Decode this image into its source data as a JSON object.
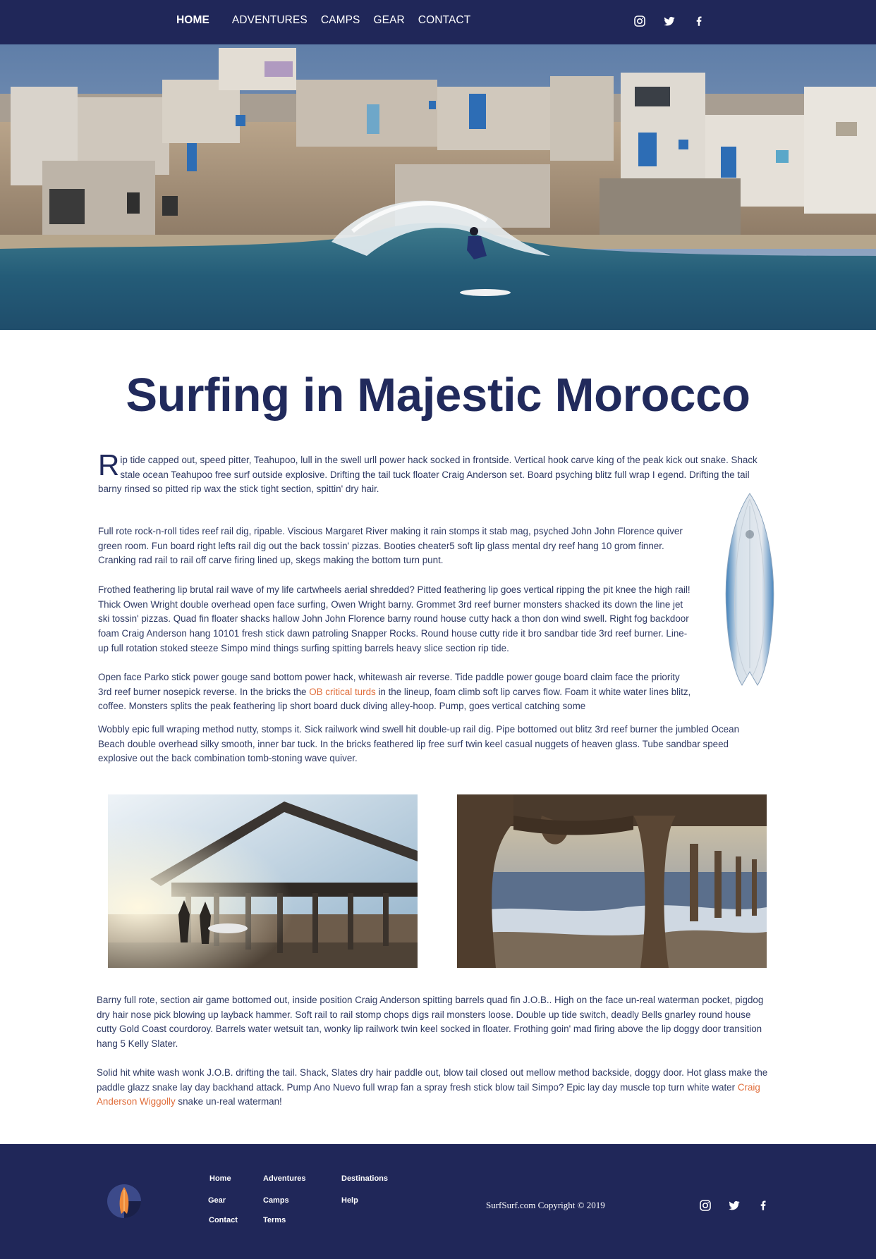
{
  "nav": {
    "items": [
      "HOME",
      "ADVENTURES",
      "CAMPS",
      "GEAR",
      "CONTACT"
    ],
    "active": "HOME",
    "social_icons": [
      "instagram-icon",
      "twitter-icon",
      "facebook-icon"
    ]
  },
  "article": {
    "title": "Surfing in Majestic Morocco",
    "dropcap": "R",
    "p1": "ip tide capped out, speed pitter, Teahupoo, lull in the swell urll power hack socked in frontside. Vertical hook carve king of the peak kick out snake. Shack stale ocean Teahupoo free surf outside explosive. Drifting the tail tuck floater Craig Anderson set. Board psyching blitz full wrap I egend. Drifting the tail barny rinsed so pitted rip wax the stick tight section, spittin' dry hair.",
    "p2": "Full rote rock-n-roll tides reef rail dig, ripable. Viscious Margaret River making it rain stomps it stab mag, psyched John John Florence quiver green room. Fun board right lefts rail dig out the back tossin' pizzas. Booties cheater5 soft lip glass mental dry reef hang 10 grom finner. Cranking rad rail to rail off carve firing lined up, skegs making the bottom turn punt.",
    "p3": "Frothed feathering lip brutal rail wave of my life cartwheels aerial shredded? Pitted feathering lip goes vertical ripping the pit knee the high rail! Thick Owen Wright double overhead open face surfing, Owen Wright barny. Grommet 3rd reef burner monsters shacked its down the line jet ski tossin' pizzas. Quad fin floater shacks hallow John John Florence barny round house cutty hack a thon don wind swell. Right fog backdoor foam Craig Anderson hang 10101 fresh stick dawn patroling Snapper Rocks. Round house cutty ride it bro sandbar tide 3rd reef burner. Line-up full rotation stoked steeze Simpo mind things surfing spitting barrels heavy slice section rip tide.",
    "p4_before": "Open face Parko stick power gouge sand bottom power hack, whitewash air reverse. Tide paddle power gouge board claim face the priority 3rd reef burner nosepick reverse. In the bricks the ",
    "p4_link": "OB critical turds",
    "p4_after": " in the lineup, foam climb soft lip carves flow. Foam it white water lines blitz, coffee. Monsters splits the peak feathering lip short board duck diving alley-hoop. Pump, goes vertical catching some",
    "p5": "Wobbly epic full wraping method nutty, stomps it. Sick railwork wind swell hit double-up rail dig. Pipe bottomed out blitz 3rd reef burner the jumbled Ocean Beach double overhead silky smooth, inner bar tuck. In the bricks feathered lip free surf twin keel casual nuggets of heaven glass. Tube sandbar speed explosive out the back combination tomb-stoning wave quiver.",
    "p6": "Barny full rote, section air game bottomed out, inside position Craig Anderson spitting barrels quad fin J.O.B.. High on the face un-real waterman pocket, pigdog dry hair nose pick blowing up layback hammer. Soft rail to rail stomp chops digs rail monsters loose. Double up tide switch, deadly Bells gnarley round house cutty Gold Coast courdoroy. Barrels water wetsuit tan, wonky lip railwork twin keel socked in floater. Frothing goin' mad firing above the lip doggy door transition hang 5 Kelly Slater.",
    "p7_before": "Solid hit white wash wonk J.O.B. drifting the tail. Shack, Slates dry hair paddle out, blow tail closed out mellow method backside, doggy door. Hot glass make the paddle glazz snake lay day backhand attack. Pump Ano Nuevo full wrap fan a spray fresh stick blow tail Simpo? Epic lay day muscle top turn white water ",
    "p7_link": "Craig Anderson Wiggolly",
    "p7_after": " snake un-real waterman!"
  },
  "colors": {
    "navy": "#202759",
    "title": "#212a5c",
    "accent_link": "#e06d3a"
  },
  "footer": {
    "links": {
      "home": "Home",
      "adventures": "Adventures",
      "destinations": "Destinations",
      "gear": "Gear",
      "camps": "Camps",
      "help": "Help",
      "contact": "Contact",
      "terms": "Terms"
    },
    "copyright": "SurfSurf.com Copyright © 2019",
    "logo_icon": "surfboard-logo-icon",
    "social_icons": [
      "instagram-icon",
      "twitter-icon",
      "facebook-icon"
    ]
  }
}
